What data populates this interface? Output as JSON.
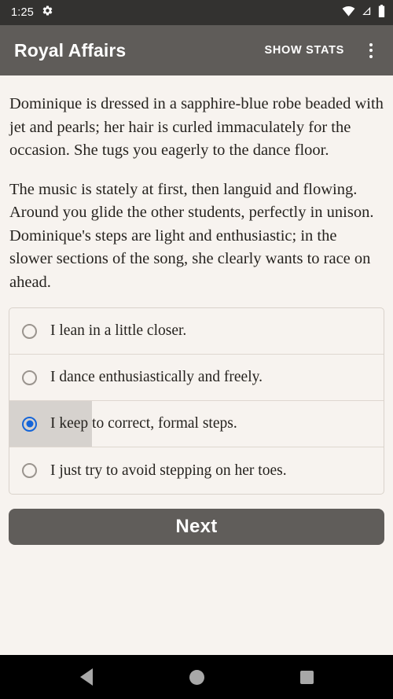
{
  "status_bar": {
    "time": "1:25",
    "icons": [
      "gear-icon",
      "wifi-icon",
      "cellular-signal-icon",
      "battery-icon"
    ]
  },
  "app_bar": {
    "title": "Royal Affairs",
    "show_stats_label": "SHOW STATS",
    "overflow_label": "More options",
    "background_color": "#5F5C59"
  },
  "story": {
    "paragraphs": [
      "Dominique is dressed in a sapphire-blue robe beaded with jet and pearls; her hair is curled immaculately for the occasion. She tugs you eagerly to the dance floor.",
      "The music is stately at first, then languid and flowing. Around you glide the other students, perfectly in unison. Dominique's steps are light and enthusiastic; in the slower sections of the song, she clearly wants to race on ahead."
    ]
  },
  "choices": {
    "selected_index": 2,
    "accent_color": "#1565D8",
    "options": [
      {
        "label": "I lean in a little closer.",
        "selected": false
      },
      {
        "label": "I dance enthusiastically and freely.",
        "selected": false
      },
      {
        "label": "I keep to correct, formal steps.",
        "selected": true
      },
      {
        "label": "I just try to avoid stepping on her toes.",
        "selected": false
      }
    ]
  },
  "next_button": {
    "label": "Next",
    "background_color": "#605D5A"
  },
  "nav_bar": {
    "back_label": "Back",
    "home_label": "Home",
    "recents_label": "Recents"
  }
}
